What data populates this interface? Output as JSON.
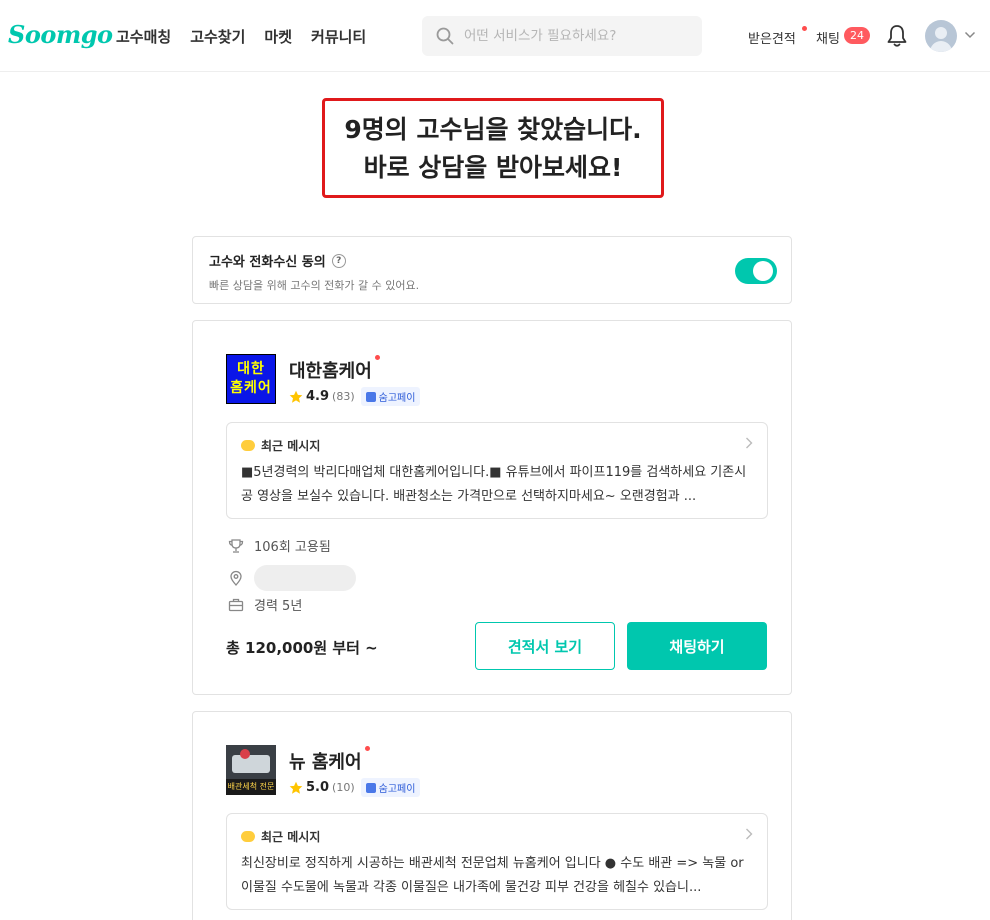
{
  "header": {
    "logo": "Soomgo",
    "nav": [
      "고수매칭",
      "고수찾기",
      "마켓",
      "커뮤니티"
    ],
    "search_placeholder": "어떤 서비스가 필요하세요?",
    "received_quotes": "받은견적",
    "chat": "채팅",
    "chat_count": "24"
  },
  "headline": {
    "line1": "9명의 고수님을 찾았습니다.",
    "line2": "바로 상담을 받아보세요!"
  },
  "consent": {
    "title": "고수와 전화수신 동의",
    "help": "?",
    "description": "빠른 상담을 위해 고수의 전화가 갈 수 있어요.",
    "enabled": true
  },
  "pros": [
    {
      "logo_text_1": "대한",
      "logo_text_2": "홈케어",
      "name": "대한홈케어",
      "rating": "4.9",
      "reviews": "(83)",
      "pay_badge": "숨고페이",
      "message_title": "최근 메시지",
      "message": "■5년경력의 박리다매업체 대한홈케어입니다.■ 유튜브에서 파이프119를 검색하세요 기존시공 영상을 보실수 있습니다. 배관청소는 가격만으로 선택하지마세요~ 오랜경험과 ...",
      "hired": "106회 고용됨",
      "career": "경력 5년",
      "price": "총 120,000원 부터 ~",
      "quote_button": "견적서 보기",
      "chat_button": "채팅하기"
    },
    {
      "logo_caption": "배관세척 전문",
      "name": "뉴 홈케어",
      "rating": "5.0",
      "reviews": "(10)",
      "pay_badge": "숨고페이",
      "message_title": "최근 메시지",
      "message": "최신장비로 정직하게 시공하는 배관세척 전문업체 뉴홈케어 입니다 ● 수도 배관 => 녹물 or 이물질 수도물에 녹물과 각종 이물질은 내가족에 물건강 피부 건강을 헤칠수 있습니..."
    }
  ],
  "colors": {
    "brand": "#00c7ae",
    "highlight_border": "#e0191b",
    "badge_red": "#ff5a5f"
  }
}
